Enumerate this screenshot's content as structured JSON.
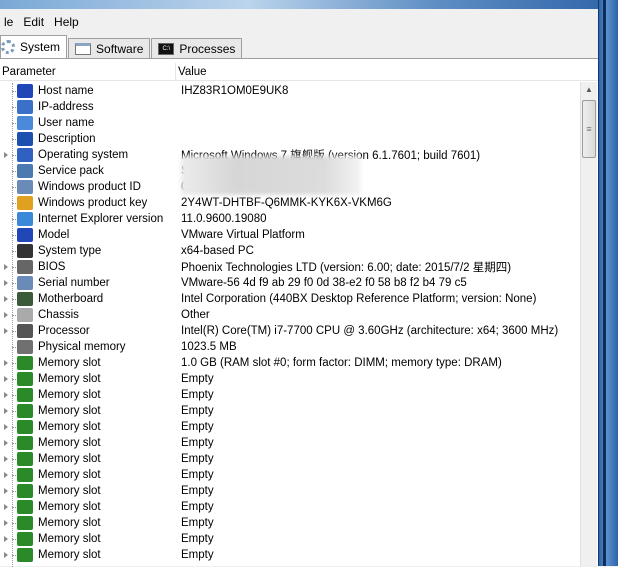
{
  "menu": [
    "le",
    "Edit",
    "Help"
  ],
  "tabs": [
    {
      "label": "System",
      "icon": "gear-icon"
    },
    {
      "label": "Software",
      "icon": "window-icon"
    },
    {
      "label": "Processes",
      "icon": "console-icon"
    }
  ],
  "columns": {
    "parameter": "Parameter",
    "value": "Value"
  },
  "rows": [
    {
      "name": "Host name",
      "value": "IHZ83R1OM0E9UK8",
      "icon": "computer-icon",
      "color": "#2046b8",
      "expand": false
    },
    {
      "name": "IP-address",
      "value": "",
      "icon": "network-icon",
      "color": "#3a70c8",
      "expand": false
    },
    {
      "name": "User name",
      "value": "",
      "icon": "user-icon",
      "color": "#4a8ad8",
      "expand": false
    },
    {
      "name": "Description",
      "value": "",
      "icon": "info-icon",
      "color": "#1c4fb0",
      "expand": false
    },
    {
      "name": "Operating system",
      "value": "Microsoft Windows 7 旗舰版 (version 6.1.7601; build 7601)",
      "icon": "os-icon",
      "color": "#3060c0",
      "expand": true
    },
    {
      "name": "Service pack",
      "value": "Service Pack 1",
      "icon": "package-icon",
      "color": "#4a7ab0",
      "expand": false
    },
    {
      "name": "Windows product ID",
      "value": "00426-OEM-8992662-00173",
      "icon": "hash-icon",
      "color": "#6a8ab8",
      "expand": false
    },
    {
      "name": "Windows product key",
      "value": "2Y4WT-DHTBF-Q6MMK-KYK6X-VKM6G",
      "icon": "key-icon",
      "color": "#e0a020",
      "expand": false
    },
    {
      "name": "Internet Explorer version",
      "value": "11.0.9600.19080",
      "icon": "ie-icon",
      "color": "#3a88d8",
      "expand": false
    },
    {
      "name": "Model",
      "value": "VMware Virtual Platform",
      "icon": "computer-icon",
      "color": "#2046b8",
      "expand": false
    },
    {
      "name": "System type",
      "value": "x64-based PC",
      "icon": "chip-icon",
      "color": "#333333",
      "expand": false
    },
    {
      "name": "BIOS",
      "value": "Phoenix Technologies LTD (version: 6.00; date: 2015/7/2 星期四)",
      "icon": "bios-chip-icon",
      "color": "#666666",
      "expand": true
    },
    {
      "name": "Serial number",
      "value": "VMware-56 4d f9 ab 29 f0 0d 38-e2 f0 58 b8 f2 b4 79 c5",
      "icon": "hash-icon",
      "color": "#6a8ab8",
      "expand": true
    },
    {
      "name": "Motherboard",
      "value": "Intel Corporation (440BX Desktop Reference Platform; version: None)",
      "icon": "motherboard-icon",
      "color": "#3a5a3a",
      "expand": true
    },
    {
      "name": "Chassis",
      "value": "Other",
      "icon": "chassis-icon",
      "color": "#aaaaaa",
      "expand": true
    },
    {
      "name": "Processor",
      "value": "Intel(R) Core(TM) i7-7700 CPU @ 3.60GHz (architecture: x64; 3600 MHz)",
      "icon": "cpu-icon",
      "color": "#555555",
      "expand": true
    },
    {
      "name": "Physical memory",
      "value": "1023.5 MB",
      "icon": "memory-icon",
      "color": "#707070",
      "expand": false
    },
    {
      "name": "Memory slot",
      "value": "1.0 GB (RAM slot #0; form factor: DIMM; memory type: DRAM)",
      "icon": "ram-icon",
      "color": "#2a8a2a",
      "expand": true
    },
    {
      "name": "Memory slot",
      "value": "Empty",
      "icon": "ram-icon",
      "color": "#2a8a2a",
      "expand": true
    },
    {
      "name": "Memory slot",
      "value": "Empty",
      "icon": "ram-icon",
      "color": "#2a8a2a",
      "expand": true
    },
    {
      "name": "Memory slot",
      "value": "Empty",
      "icon": "ram-icon",
      "color": "#2a8a2a",
      "expand": true
    },
    {
      "name": "Memory slot",
      "value": "Empty",
      "icon": "ram-icon",
      "color": "#2a8a2a",
      "expand": true
    },
    {
      "name": "Memory slot",
      "value": "Empty",
      "icon": "ram-icon",
      "color": "#2a8a2a",
      "expand": true
    },
    {
      "name": "Memory slot",
      "value": "Empty",
      "icon": "ram-icon",
      "color": "#2a8a2a",
      "expand": true
    },
    {
      "name": "Memory slot",
      "value": "Empty",
      "icon": "ram-icon",
      "color": "#2a8a2a",
      "expand": true
    },
    {
      "name": "Memory slot",
      "value": "Empty",
      "icon": "ram-icon",
      "color": "#2a8a2a",
      "expand": true
    },
    {
      "name": "Memory slot",
      "value": "Empty",
      "icon": "ram-icon",
      "color": "#2a8a2a",
      "expand": true
    },
    {
      "name": "Memory slot",
      "value": "Empty",
      "icon": "ram-icon",
      "color": "#2a8a2a",
      "expand": true
    },
    {
      "name": "Memory slot",
      "value": "Empty",
      "icon": "ram-icon",
      "color": "#2a8a2a",
      "expand": true
    },
    {
      "name": "Memory slot",
      "value": "Empty",
      "icon": "ram-icon",
      "color": "#2a8a2a",
      "expand": true
    }
  ]
}
